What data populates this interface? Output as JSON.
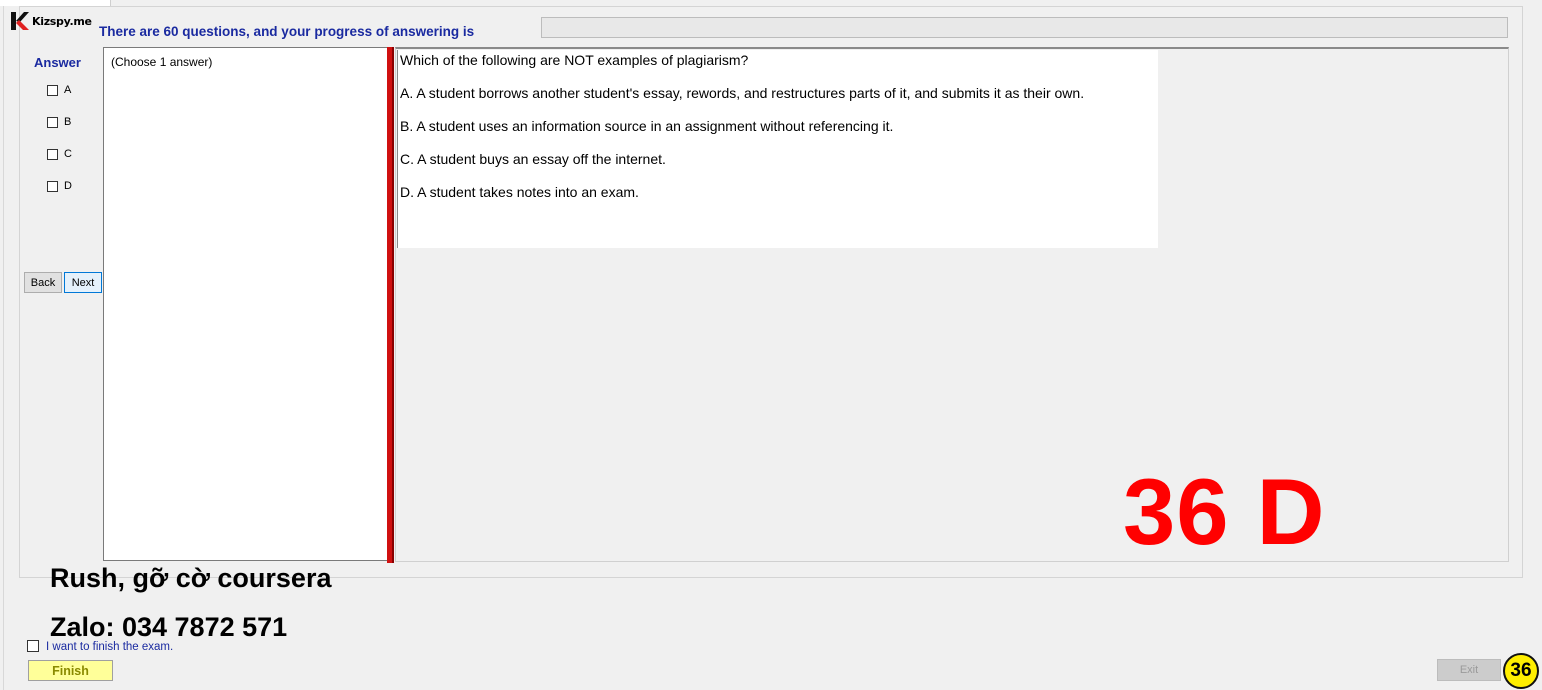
{
  "logo": {
    "text": "Kizspy.me"
  },
  "header": {
    "progress_text": "There are 60 questions, and your progress of answering is",
    "progress_fraction": 0
  },
  "answer_panel": {
    "title": "Answer",
    "options": [
      "A",
      "B",
      "C",
      "D"
    ],
    "back_label": "Back",
    "next_label": "Next"
  },
  "choose_panel": {
    "text": "(Choose 1 answer)"
  },
  "question": {
    "text": "Which of the following are NOT examples of plagiarism?",
    "options": [
      "A.  A student borrows another student's essay, rewords, and restructures parts of it, and submits it as their own.",
      "B.  A student uses an information source in an assignment without referencing it.",
      "C.  A student buys an essay off the internet.",
      "D.  A student takes notes into an exam."
    ]
  },
  "overlay": {
    "answer": "36 D",
    "promo_line_1": "Rush, gỡ cờ coursera",
    "promo_line_2": "Zalo: 034 7872 571"
  },
  "footer": {
    "finish_check_label": "I want to finish the exam.",
    "finish_label": "Finish",
    "exit_label": "Exit",
    "question_number": "36"
  },
  "colors": {
    "header_text": "#1a2aa0",
    "splitter": "#d01010",
    "answer_overlay": "#ff0000",
    "finish_button": "#ffff99",
    "badge": "#ffee00"
  }
}
